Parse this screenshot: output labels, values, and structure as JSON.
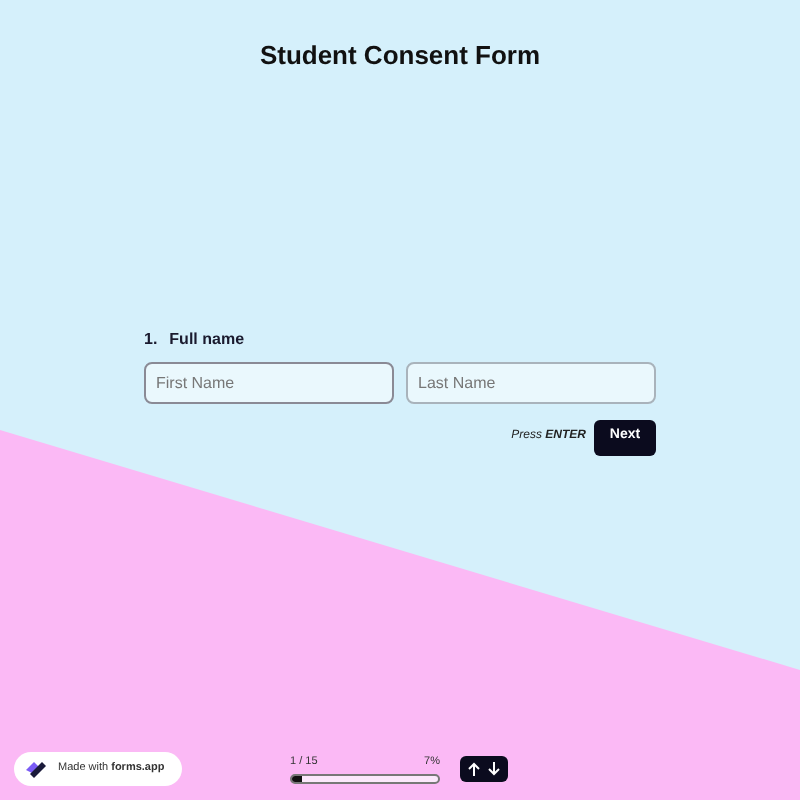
{
  "title": "Student Consent Form",
  "question": {
    "number": "1.",
    "label": "Full name",
    "fields": [
      {
        "placeholder": "First Name",
        "focused": true
      },
      {
        "placeholder": "Last Name",
        "focused": false
      }
    ]
  },
  "hint": "Press **ENTER**",
  "next_button": "Next",
  "badge": {
    "prefix": "Made with",
    "brand": "forms.app"
  },
  "progress": {
    "count": "1 / 15",
    "percent": "7%",
    "level": 0.07
  }
}
